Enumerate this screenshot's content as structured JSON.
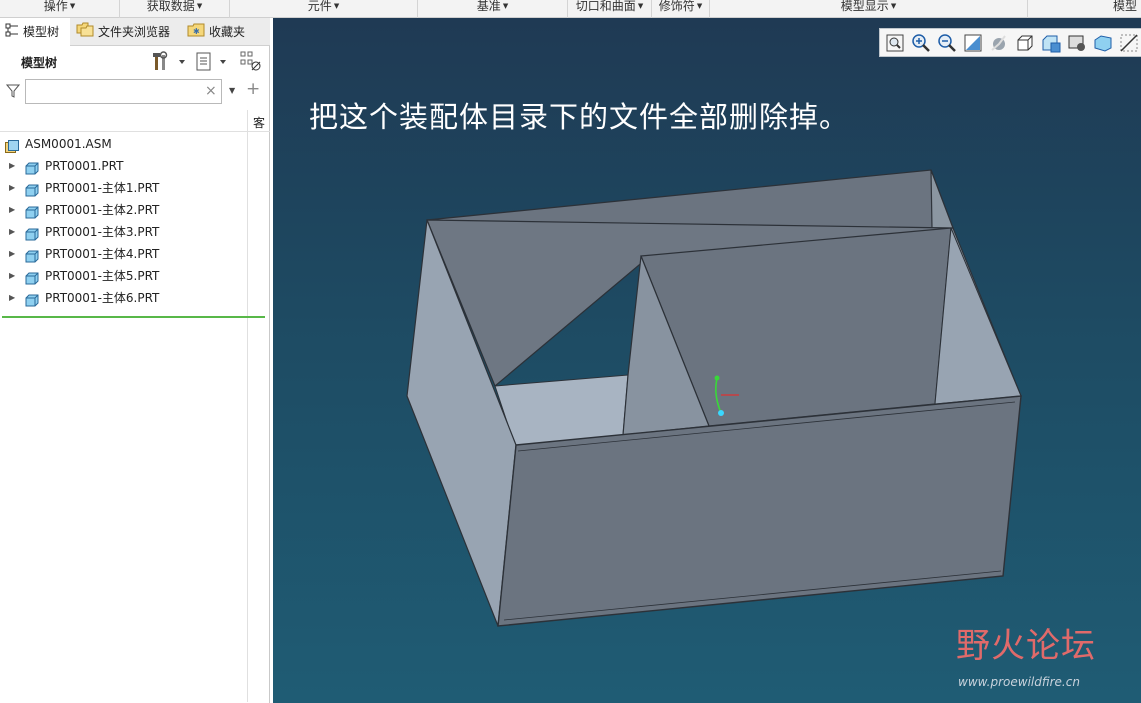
{
  "ribbon": {
    "groups": [
      {
        "label": "操作"
      },
      {
        "label": "获取数据"
      },
      {
        "label": "元件"
      },
      {
        "label": "基准"
      },
      {
        "label": "切口和曲面"
      },
      {
        "label": "修饰符"
      },
      {
        "label": "模型显示"
      },
      {
        "label": "模型"
      }
    ]
  },
  "panel": {
    "tabs": [
      {
        "label": "模型树"
      },
      {
        "label": "文件夹浏览器"
      },
      {
        "label": "收藏夹"
      }
    ],
    "tree_title": "模型树",
    "filter_value": "",
    "column_header": "客"
  },
  "tree": {
    "root": "ASM0001.ASM",
    "items": [
      {
        "label": "PRT0001.PRT"
      },
      {
        "label": "PRT0001-主体1.PRT"
      },
      {
        "label": "PRT0001-主体2.PRT"
      },
      {
        "label": "PRT0001-主体3.PRT"
      },
      {
        "label": "PRT0001-主体4.PRT"
      },
      {
        "label": "PRT0001-主体5.PRT"
      },
      {
        "label": "PRT0001-主体6.PRT"
      }
    ]
  },
  "viewport": {
    "annotation": "把这个装配体目录下的文件全部删除掉。",
    "watermark_text": "野火论坛",
    "watermark_url": "www.proewildfire.cn",
    "toolbar_icons": [
      "refit-icon",
      "zoom-in-icon",
      "zoom-out-icon",
      "repaint-icon",
      "display-style-icon",
      "saved-orientations-icon",
      "view-manager-icon",
      "perspective-icon",
      "datum-display-icon",
      "annotation-display-icon"
    ]
  },
  "colors": {
    "viewport_top": "#1f3a54",
    "viewport_bottom": "#1f5c74",
    "insert_line": "#58b848"
  }
}
